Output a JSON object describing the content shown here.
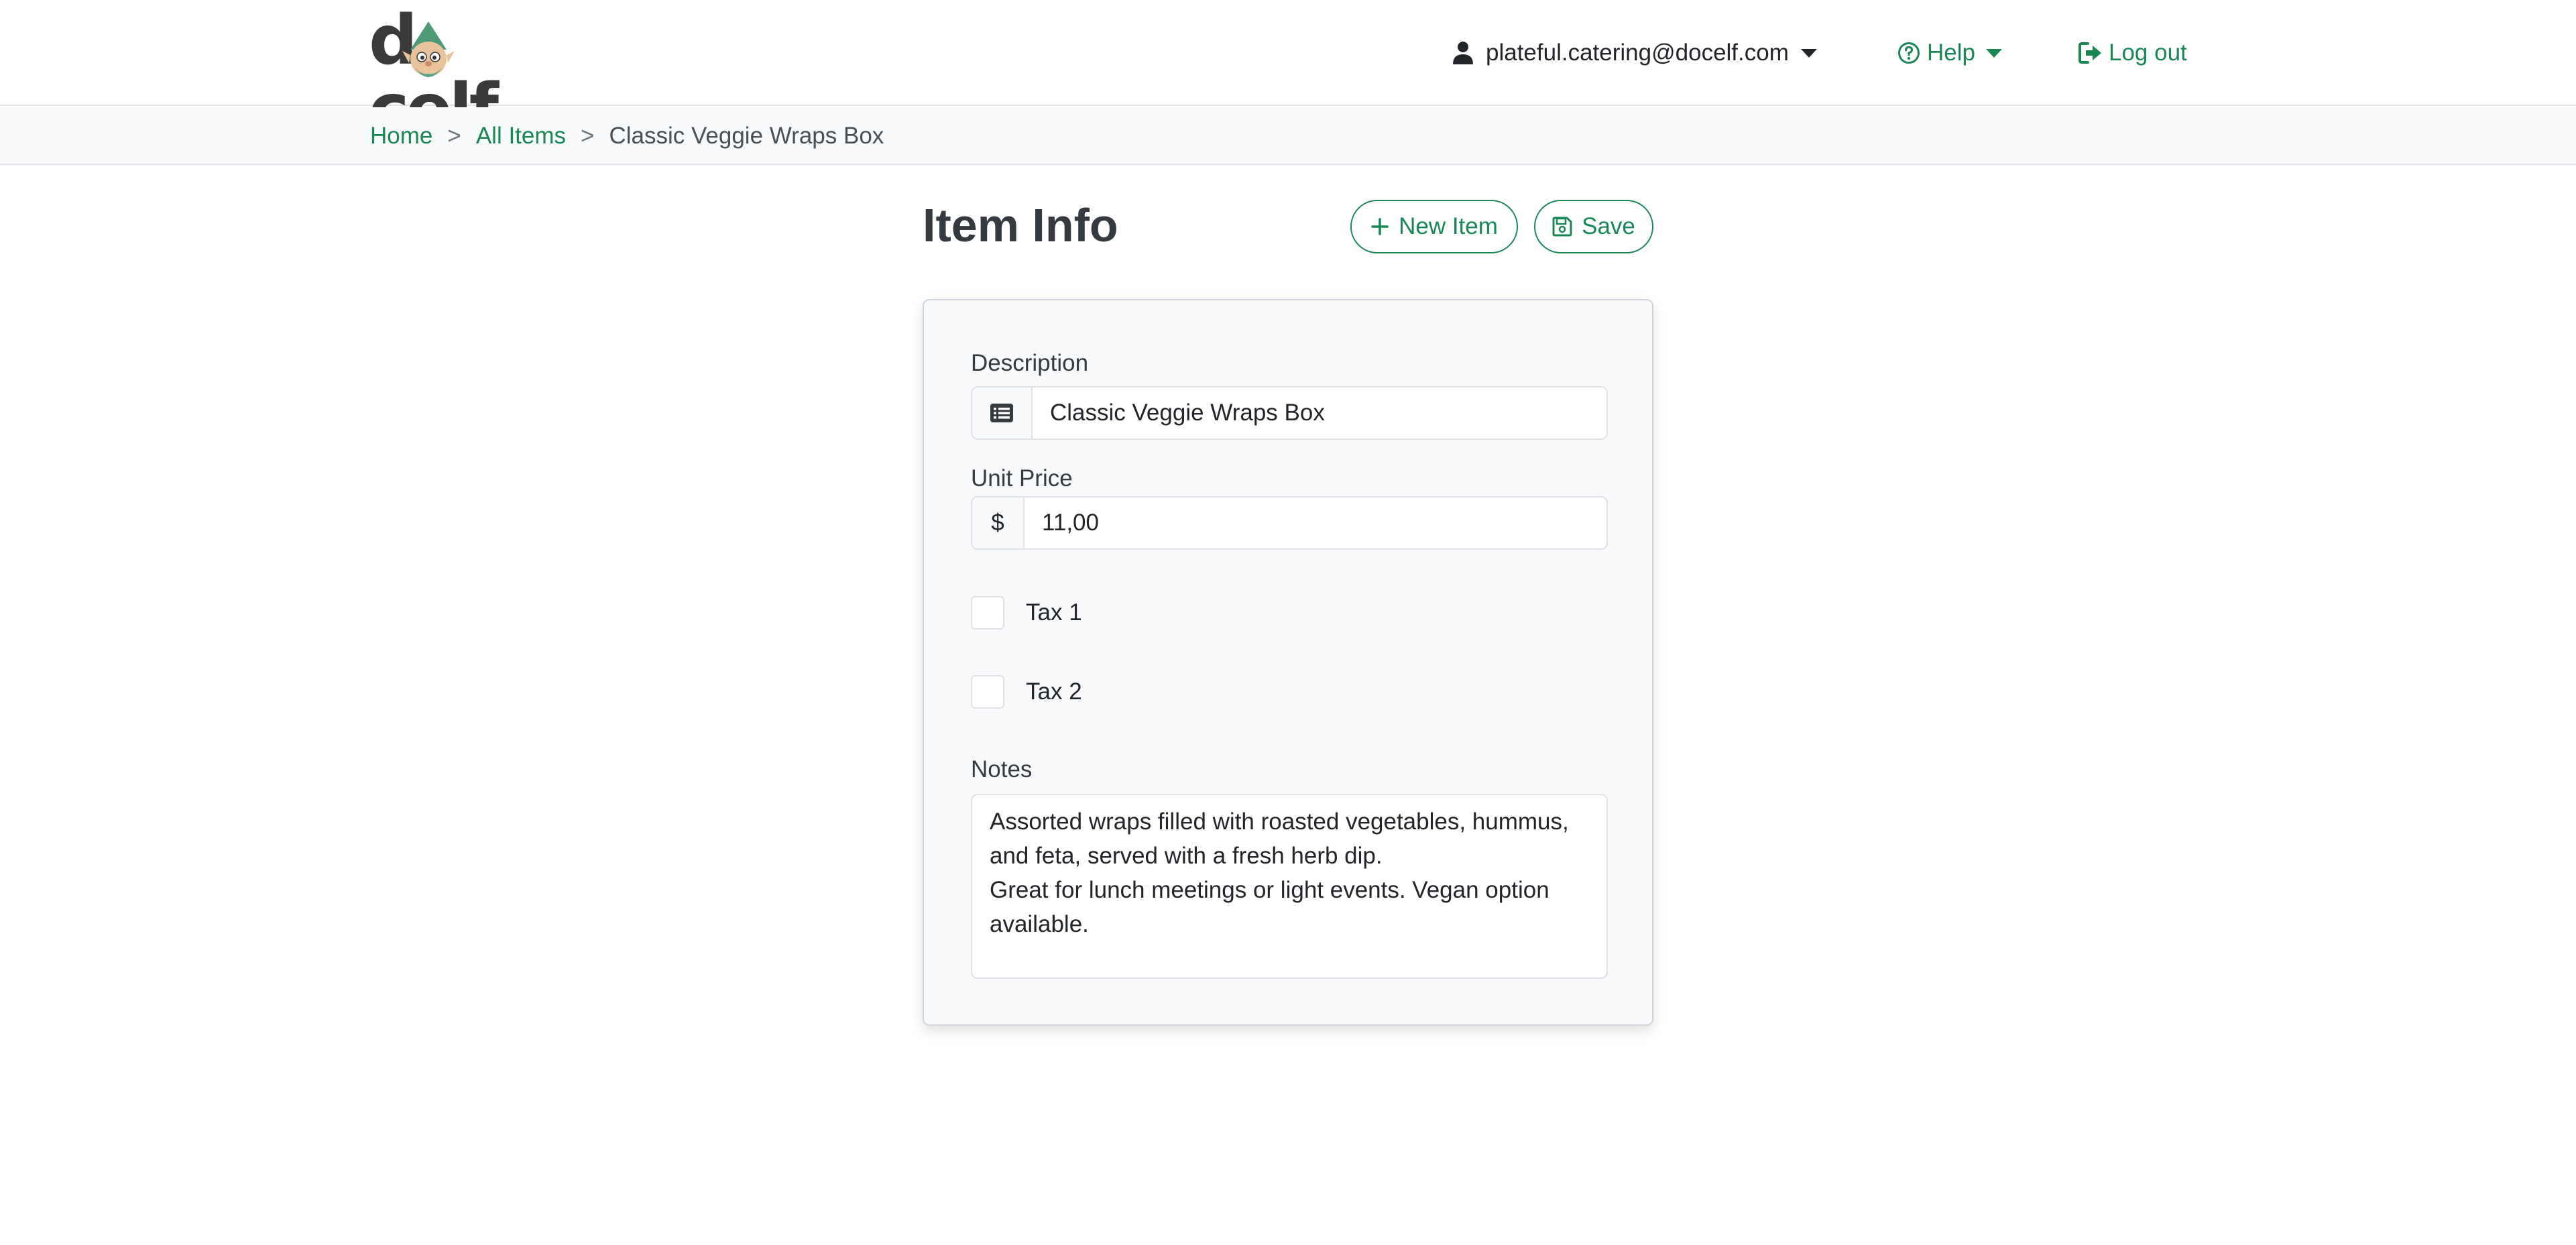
{
  "brand": {
    "logo_text": "docelf"
  },
  "nav": {
    "user_email": "plateful.catering@docelf.com",
    "help_label": "Help",
    "logout_label": "Log out"
  },
  "breadcrumb": {
    "home": "Home",
    "all_items": "All Items",
    "current": "Classic Veggie Wraps Box",
    "separator": ">"
  },
  "page": {
    "title": "Item Info",
    "new_item_label": "New Item",
    "save_label": "Save"
  },
  "form": {
    "description_label": "Description",
    "description_value": "Classic Veggie Wraps Box",
    "unit_price_label": "Unit Price",
    "currency_symbol": "$",
    "unit_price_value": "11,00",
    "tax1_label": "Tax 1",
    "tax1_checked": false,
    "tax2_label": "Tax 2",
    "tax2_checked": false,
    "notes_label": "Notes",
    "notes_lines": [
      "Assorted wraps filled with roasted vegetables, hummus,",
      "and feta, served with a fresh herb dip.",
      "Great for lunch meetings or light events. Vegan option",
      "available."
    ]
  },
  "colors": {
    "accent": "#198754",
    "text": "#212529",
    "card_bg": "#f8f9fa",
    "border": "#dee2e6"
  },
  "icons": {
    "user": "user-icon",
    "help": "question-circle-icon",
    "logout": "sign-out-icon",
    "new_item": "plus-icon",
    "save": "floppy-disk-icon",
    "description": "list-icon"
  }
}
